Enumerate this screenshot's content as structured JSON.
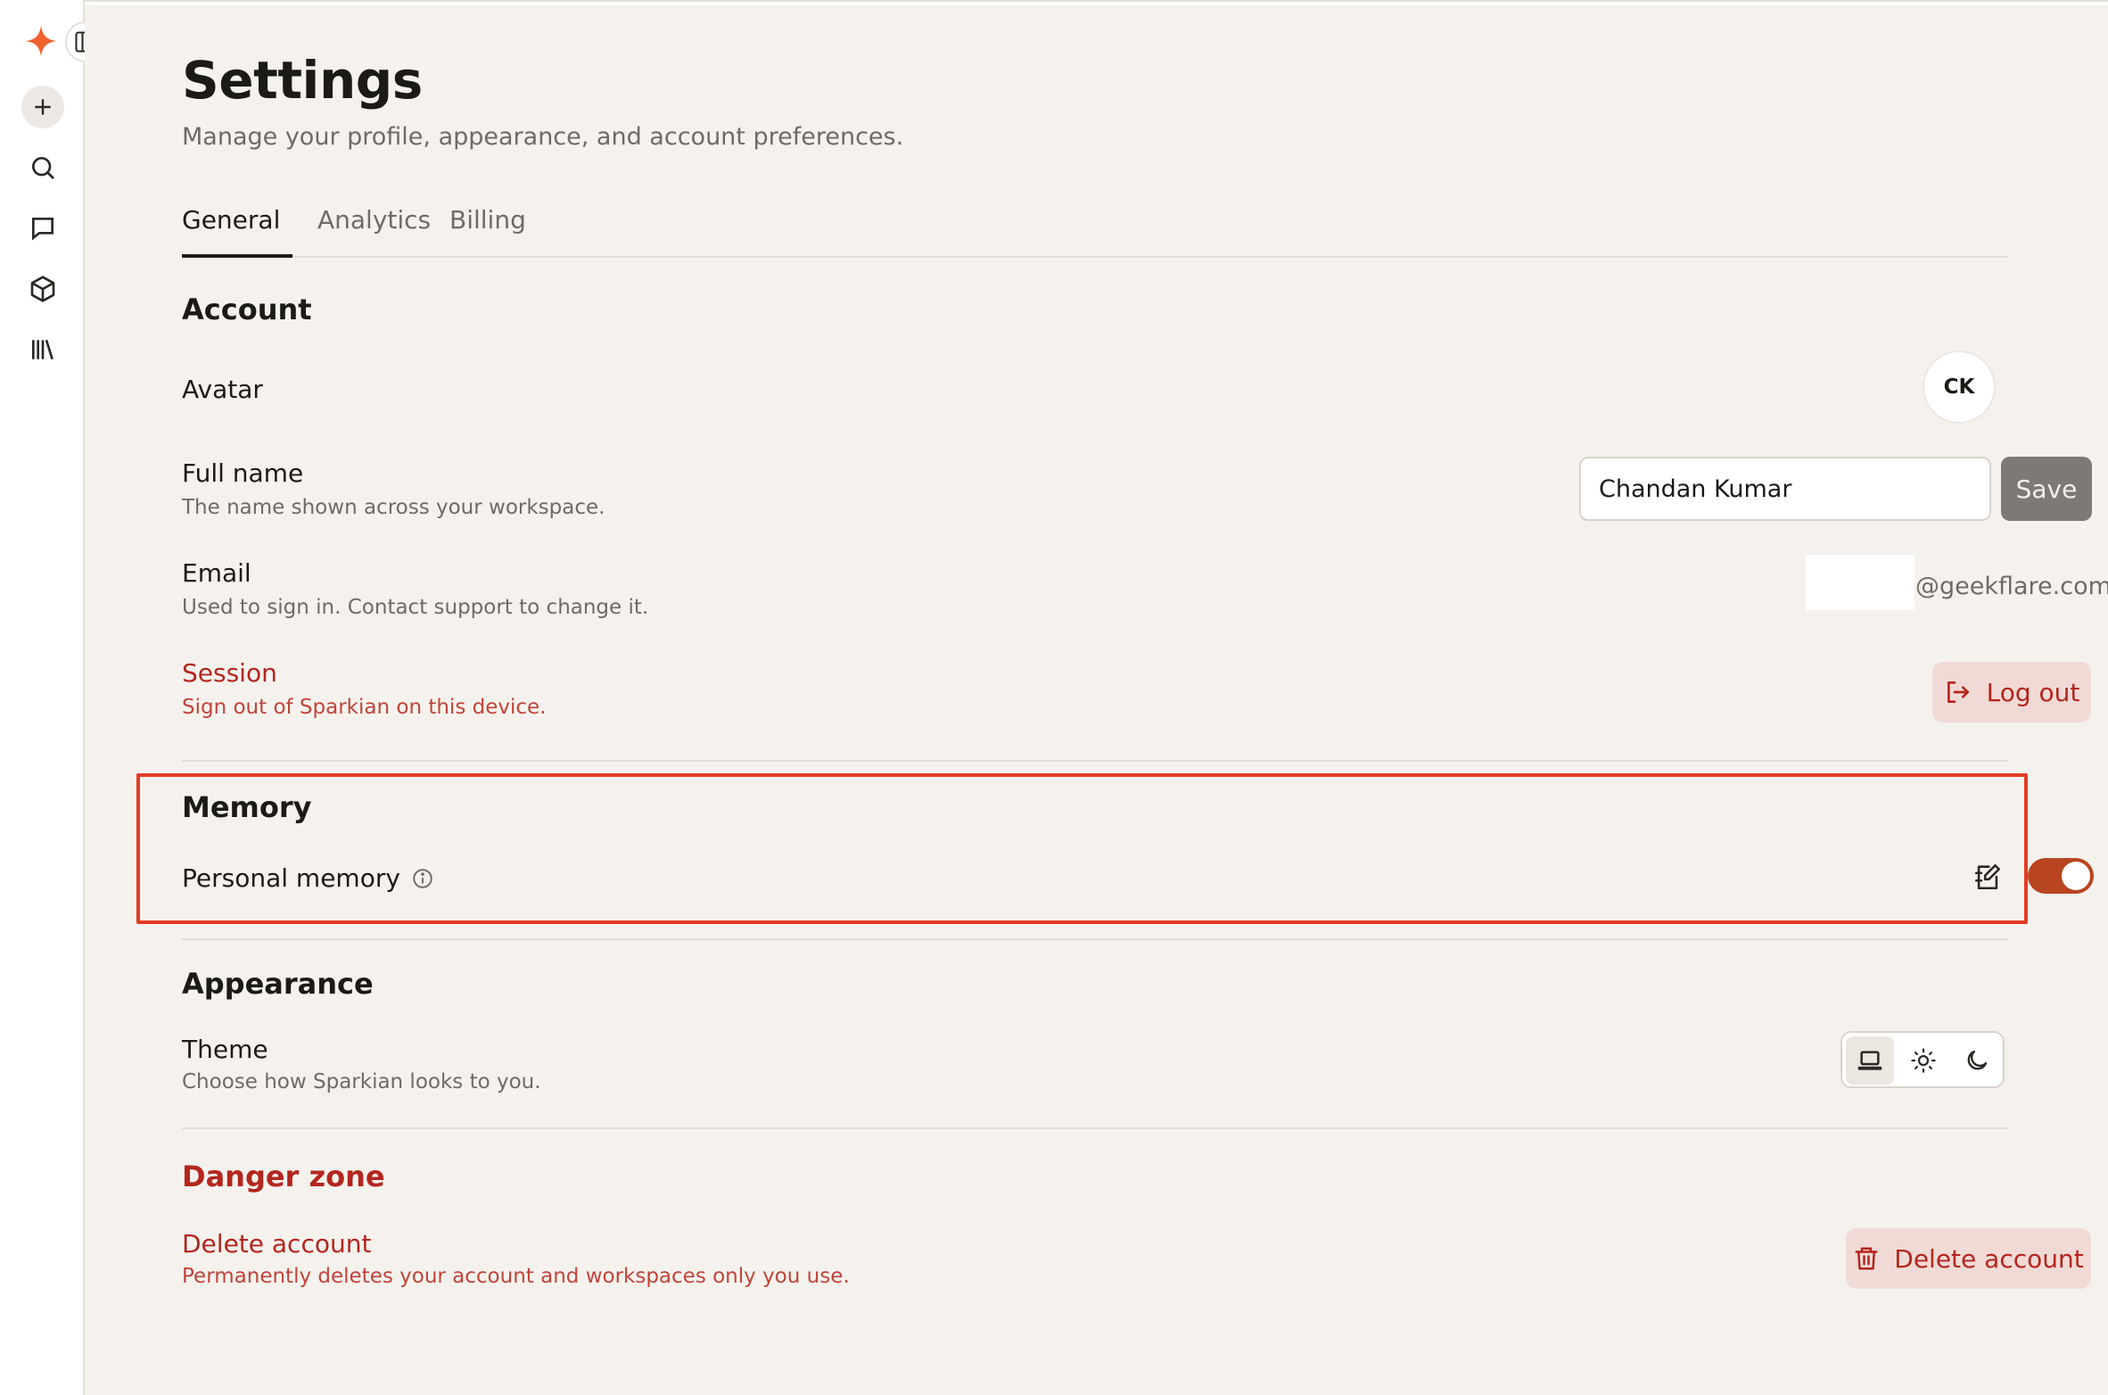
{
  "settings": {
    "title": "Settings",
    "subtitle": "Manage your profile, appearance, and account preferences.",
    "tabs": [
      {
        "label": "General",
        "active": true
      },
      {
        "label": "Analytics",
        "active": false
      },
      {
        "label": "Billing",
        "active": false
      }
    ]
  },
  "sidebar": {
    "icons": [
      "sparkle-logo-icon",
      "toggle-sidebar-icon",
      "new-chat-icon",
      "search-icon",
      "chats-icon",
      "projects-icon",
      "library-icon"
    ]
  },
  "account": {
    "heading": "Account",
    "avatar_label": "Avatar",
    "avatar_initials": "CK",
    "full_name_label": "Full name",
    "full_name_desc": "The name shown across your workspace.",
    "full_name_value": "Chandan Kumar",
    "save_label": "Save",
    "email_label": "Email",
    "email_desc": "Used to sign in. Contact support to change it.",
    "email_value": "@geekflare.com",
    "session_label": "Session",
    "session_desc": "Sign out of Sparkian on this device.",
    "logout_label": "Log out"
  },
  "memory": {
    "heading": "Memory",
    "personal_memory_label": "Personal memory",
    "enabled": true
  },
  "appearance": {
    "heading": "Appearance",
    "theme_label": "Theme",
    "theme_desc": "Choose how Sparkian looks to you.",
    "theme_options": [
      "system",
      "light",
      "dark"
    ],
    "selected_theme": "system"
  },
  "danger_zone": {
    "heading": "Danger zone",
    "delete_label": "Delete account",
    "delete_desc": "Permanently deletes your account and workspaces only you use.",
    "delete_button": "Delete account"
  },
  "colors": {
    "accent": "#b8451f",
    "danger": "#b3261e",
    "highlight": "#e23b26",
    "background": "#f5f2ed"
  }
}
